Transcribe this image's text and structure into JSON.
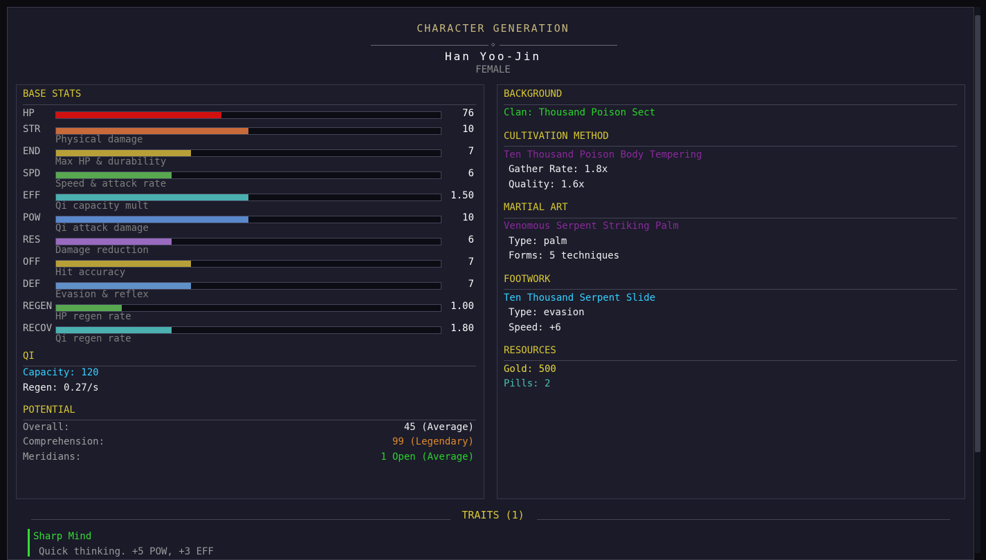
{
  "header": {
    "title": "CHARACTER GENERATION",
    "name": "Han Yoo-Jin",
    "gender": "FEMALE"
  },
  "base_stats": {
    "heading": "BASE STATS",
    "stats": [
      {
        "label": "HP",
        "value": "76",
        "fill": 0.43,
        "color": "#d11010",
        "desc": ""
      },
      {
        "label": "STR",
        "value": "10",
        "fill": 0.5,
        "color": "#c86a3a",
        "desc": "Physical damage"
      },
      {
        "label": "END",
        "value": "7",
        "fill": 0.35,
        "color": "#b8a038",
        "desc": "Max HP & durability"
      },
      {
        "label": "SPD",
        "value": "6",
        "fill": 0.3,
        "color": "#58a850",
        "desc": "Speed & attack rate"
      },
      {
        "label": "EFF",
        "value": "1.50",
        "fill": 0.5,
        "color": "#4ab0b0",
        "desc": "Qi capacity mult"
      },
      {
        "label": "POW",
        "value": "10",
        "fill": 0.5,
        "color": "#5a88cc",
        "desc": "Qi attack damage"
      },
      {
        "label": "RES",
        "value": "6",
        "fill": 0.3,
        "color": "#9a6ac0",
        "desc": "Damage reduction"
      },
      {
        "label": "OFF",
        "value": "7",
        "fill": 0.35,
        "color": "#b8a038",
        "desc": "Hit accuracy"
      },
      {
        "label": "DEF",
        "value": "7",
        "fill": 0.35,
        "color": "#6090c8",
        "desc": "Evasion & reflex"
      },
      {
        "label": "REGEN",
        "value": "1.00",
        "fill": 0.17,
        "color": "#58a850",
        "desc": "HP regen rate"
      },
      {
        "label": "RECOV",
        "value": "1.80",
        "fill": 0.3,
        "color": "#4ab0b0",
        "desc": "Qi regen rate"
      }
    ]
  },
  "qi": {
    "heading": "QI",
    "capacity": "Capacity: 120",
    "regen": "Regen: 0.27/s"
  },
  "potential": {
    "heading": "POTENTIAL",
    "rows": [
      {
        "label": "Overall:",
        "value": "45 (Average)",
        "color": "#f0f0f0"
      },
      {
        "label": "Comprehension:",
        "value": "99 (Legendary)",
        "color": "#e08a2a"
      },
      {
        "label": "Meridians:",
        "value": "1 Open  (Average)",
        "color": "#2ad42a"
      }
    ]
  },
  "background": {
    "heading": "BACKGROUND",
    "clan": "Clan: Thousand Poison Sect"
  },
  "cultivation": {
    "heading": "CULTIVATION METHOD",
    "name": "Ten Thousand Poison Body Tempering",
    "gather": "Gather Rate: 1.8x",
    "quality": "Quality: 1.6x"
  },
  "martial": {
    "heading": "MARTIAL ART",
    "name": "Venomous Serpent Striking Palm",
    "type": "Type: palm",
    "forms": "Forms: 5 techniques"
  },
  "footwork": {
    "heading": "FOOTWORK",
    "name": "Ten Thousand Serpent Slide",
    "type": "Type: evasion",
    "speed": "Speed: +6"
  },
  "resources": {
    "heading": "RESOURCES",
    "gold": "Gold: 500",
    "pills": "Pills: 2"
  },
  "traits": {
    "heading": "TRAITS (1)",
    "items": [
      {
        "name": "Sharp Mind",
        "desc": "Quick thinking. +5 POW, +3 EFF"
      }
    ]
  }
}
